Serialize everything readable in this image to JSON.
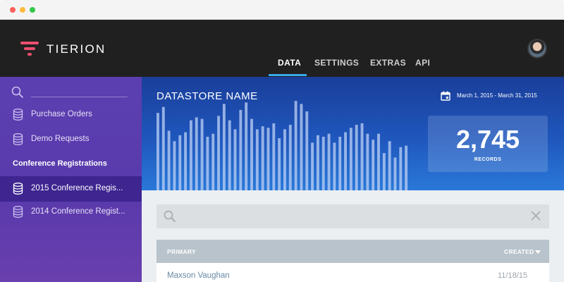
{
  "app": {
    "name": "TIERION"
  },
  "nav": {
    "items": [
      {
        "label": "DATA",
        "active": true
      },
      {
        "label": "SETTINGS",
        "active": false
      },
      {
        "label": "EXTRAS",
        "active": false
      },
      {
        "label": "API",
        "active": false
      }
    ]
  },
  "sidebar": {
    "search_placeholder": "",
    "items": [
      {
        "label": "Purchase Orders",
        "icon": "database-icon"
      },
      {
        "label": "Demo Requests",
        "icon": "database-icon"
      }
    ],
    "section_title": "Conference Registrations",
    "section_items": [
      {
        "label": "2015 Conference Regis...",
        "icon": "database-icon",
        "active": true
      },
      {
        "label": "2014 Conference Regist...",
        "icon": "database-icon",
        "active": false
      }
    ]
  },
  "hero": {
    "title": "DATASTORE NAME",
    "date_range": "March 1, 2015 - March 31, 2015",
    "records_count": "2,745",
    "records_label": "RECORDS"
  },
  "activity_bars": [
    52,
    56,
    40,
    33,
    37,
    39,
    47,
    49,
    48,
    36,
    38,
    50,
    58,
    47,
    41,
    54,
    59,
    48,
    41,
    43,
    42,
    45,
    35,
    41,
    44,
    60,
    58,
    53,
    32,
    37,
    36,
    38,
    32,
    36,
    39,
    42,
    44,
    45,
    38,
    34,
    38,
    25,
    33,
    22,
    29,
    30
  ],
  "table": {
    "search_placeholder": "",
    "col_primary": "PRIMARY",
    "col_created": "CREATED",
    "rows": [
      {
        "name": "Maxson Vaughan",
        "created": "11/18/15"
      }
    ]
  },
  "colors": {
    "topbar": "#202020",
    "accent": "#3aa8ea",
    "sidebar": "#5a3aac",
    "hero": "#1f57bd",
    "brand": "#ee4f6f"
  }
}
